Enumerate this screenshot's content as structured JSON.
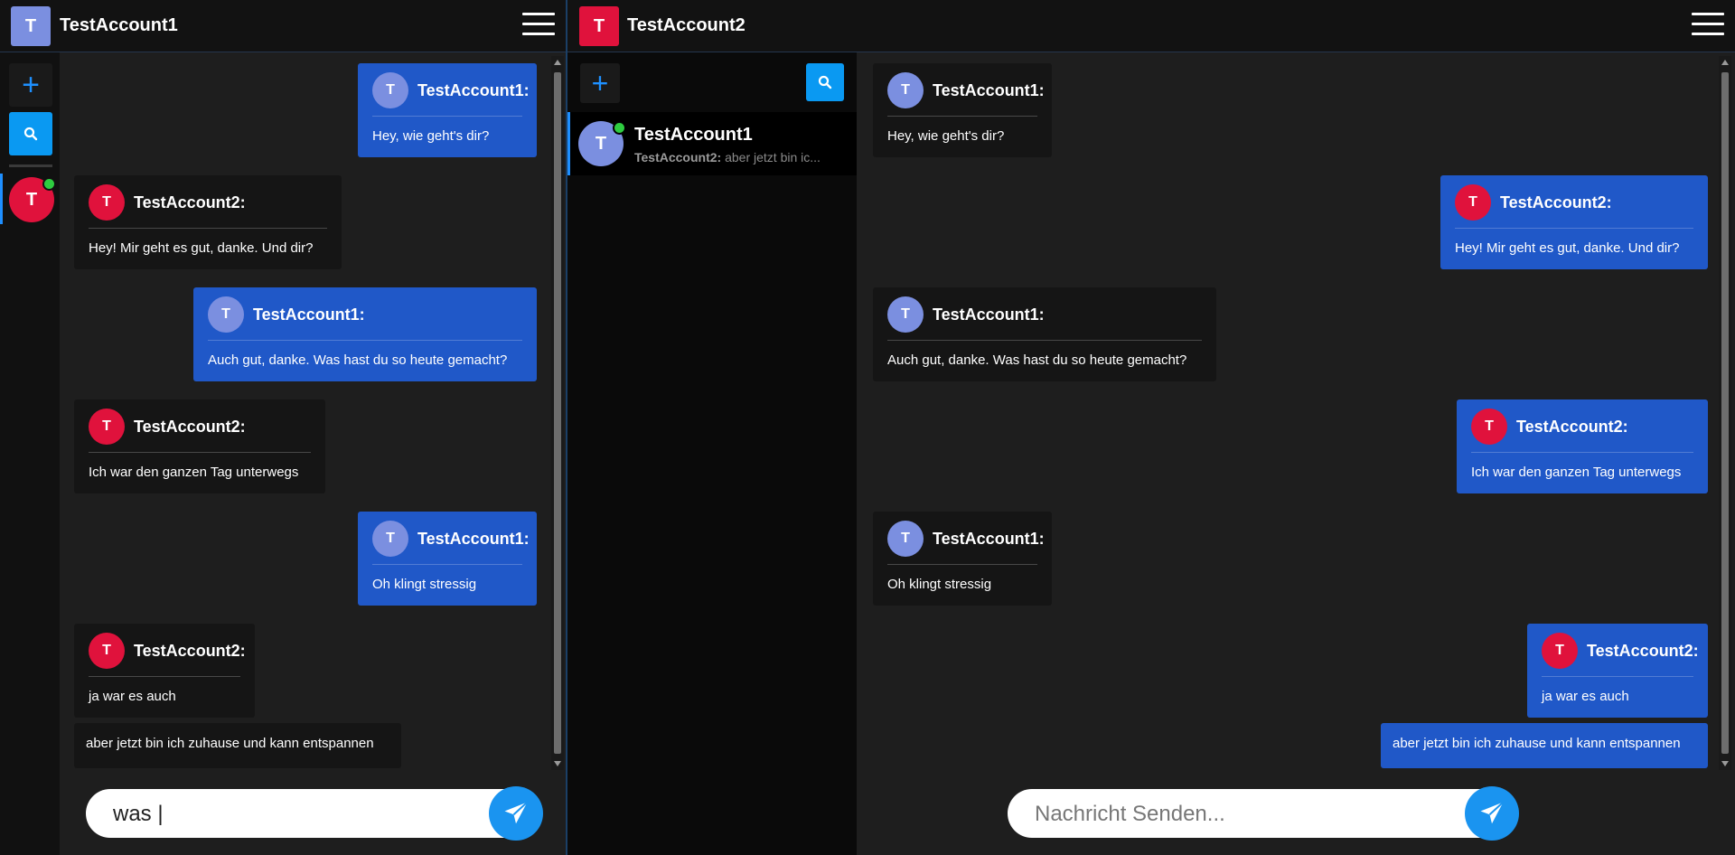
{
  "pane1": {
    "account_name": "TestAccount1",
    "account_initial": "T",
    "account_color": "#7b8fe0",
    "contact_initial": "T",
    "composer": {
      "value": "was |",
      "placeholder": "Nachricht Senden..."
    }
  },
  "pane2": {
    "account_name": "TestAccount2",
    "account_initial": "T",
    "account_color": "#e0123c",
    "contact": {
      "initial": "T",
      "name": "TestAccount1",
      "preview_sender": "TestAccount2:",
      "preview_text": "aber jetzt bin ic..."
    },
    "composer": {
      "value": "",
      "placeholder": "Nachricht Senden..."
    }
  },
  "messages": [
    {
      "sender": "TestAccount1:",
      "initial": "T",
      "text": "Hey, wie geht's dir?"
    },
    {
      "sender": "TestAccount2:",
      "initial": "T",
      "text": "Hey! Mir geht es gut, danke. Und dir?"
    },
    {
      "sender": "TestAccount1:",
      "initial": "T",
      "text": "Auch gut, danke. Was hast du so heute gemacht?"
    },
    {
      "sender": "TestAccount2:",
      "initial": "T",
      "text": "Ich war den ganzen Tag unterwegs"
    },
    {
      "sender": "TestAccount1:",
      "initial": "T",
      "text": "Oh klingt stressig"
    },
    {
      "sender": "TestAccount2:",
      "initial": "T",
      "text": "ja war es auch"
    },
    {
      "sender": "",
      "initial": "",
      "text": "aber jetzt bin ich zuhause und kann entspannen"
    }
  ],
  "icons": {
    "menu": "hamburger-icon",
    "add": "plus-icon",
    "search": "search-icon",
    "send": "paper-plane-icon"
  },
  "colors": {
    "mine_bubble": "#2058c8",
    "theirs_bubble": "#151515",
    "accent": "#1a94f0",
    "online": "#2ecc40"
  }
}
